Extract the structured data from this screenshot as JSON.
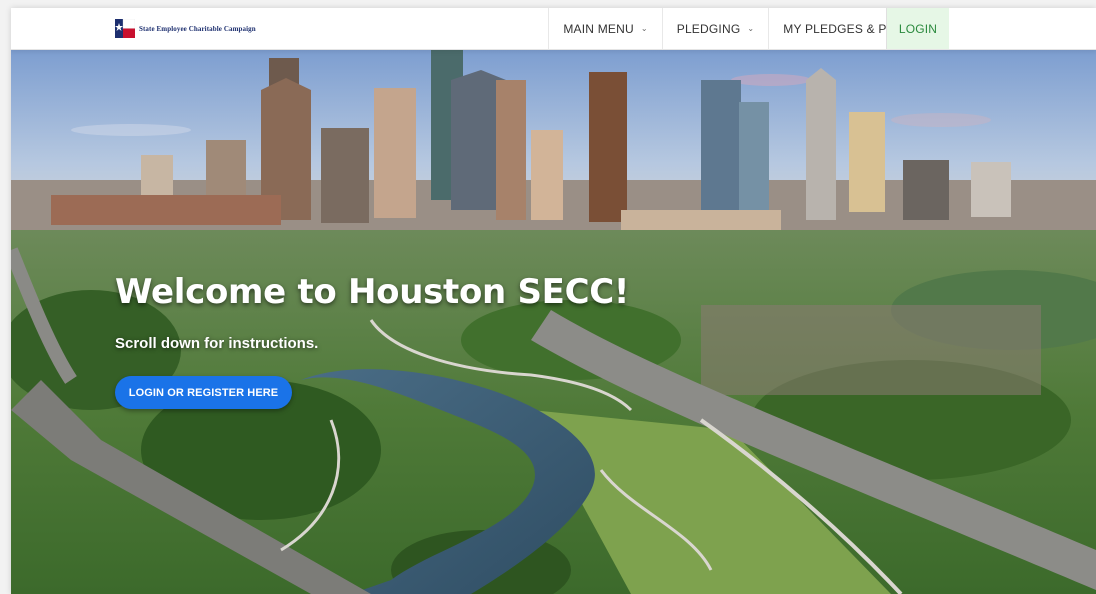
{
  "header": {
    "logo_text": "State Employee Charitable Campaign",
    "logo_icon": "texas-star-flag-icon",
    "nav": [
      {
        "label": "MAIN MENU",
        "has_dropdown": true
      },
      {
        "label": "PLEDGING",
        "has_dropdown": true
      },
      {
        "label": "MY PLEDGES & PROFILE",
        "has_dropdown": true
      }
    ],
    "login_label": "LOGIN",
    "dropdown_icon": "chevron-down-icon"
  },
  "hero": {
    "title": "Welcome to Houston SECC!",
    "subtitle": "Scroll down for instructions.",
    "cta_label": "LOGIN OR REGISTER HERE"
  },
  "colors": {
    "accent_blue": "#1a73e8",
    "login_bg": "#e6f7e6",
    "login_text": "#2b8a3e",
    "logo_navy": "#1d2f6f",
    "logo_red": "#c8102e"
  }
}
